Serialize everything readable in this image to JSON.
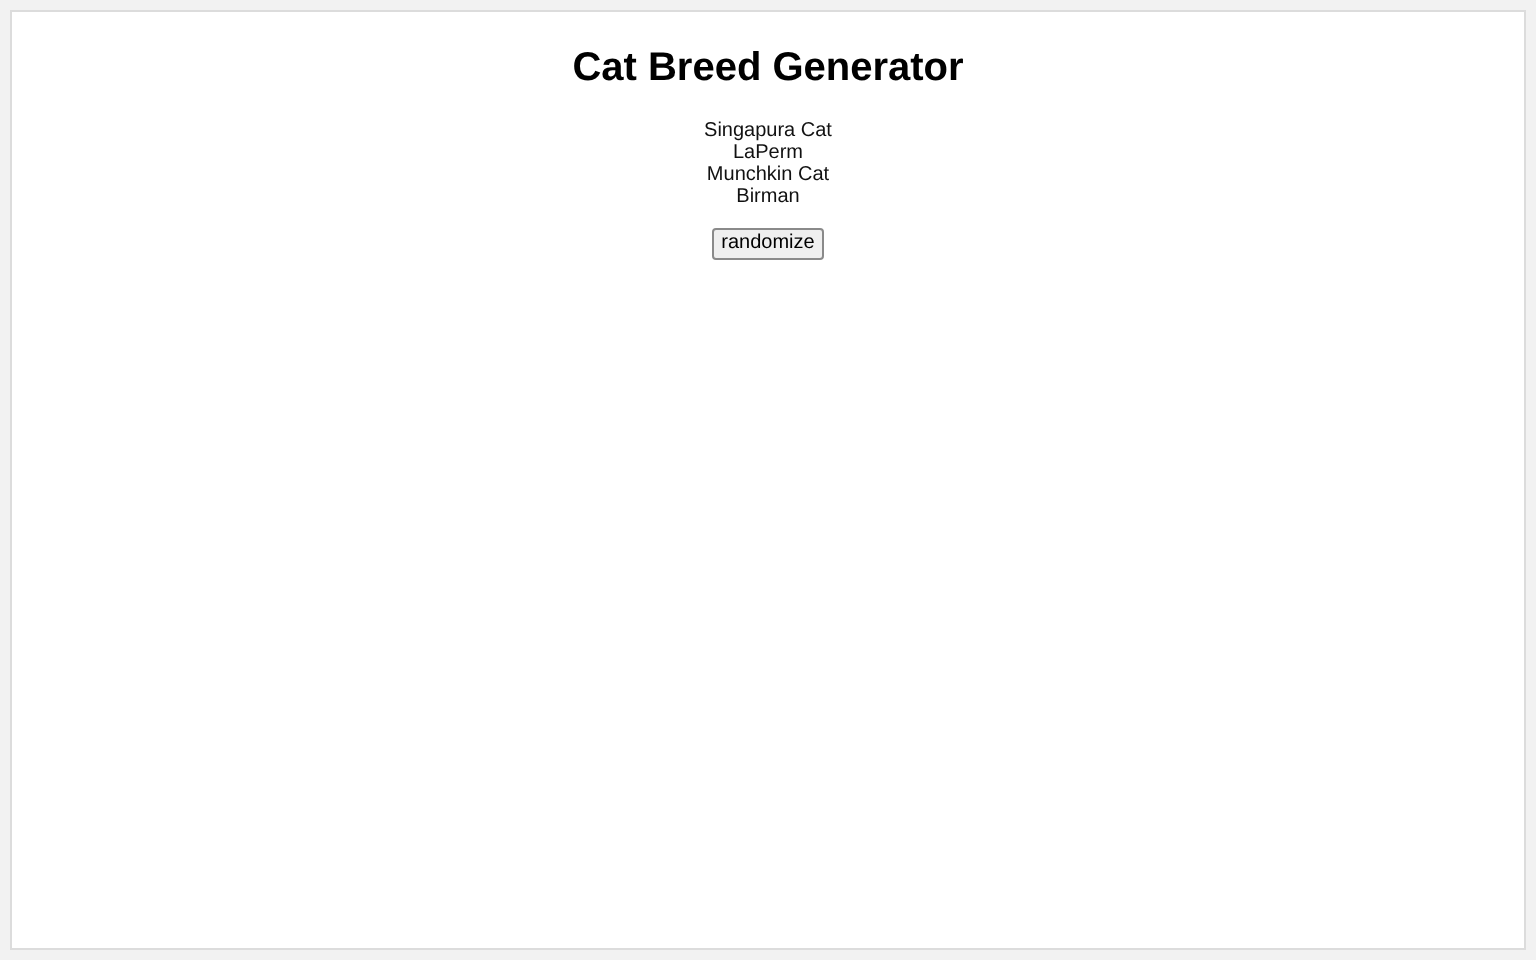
{
  "title": "Cat Breed Generator",
  "breeds": [
    "Singapura Cat",
    "LaPerm",
    "Munchkin Cat",
    "Birman"
  ],
  "button": "randomize"
}
